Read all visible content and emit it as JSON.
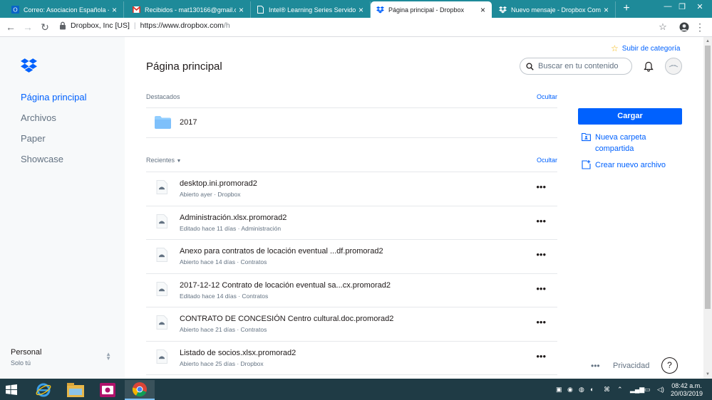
{
  "browser": {
    "tabs": [
      {
        "title": "Correo: Asociacion Española - C",
        "icon": "outlook-icon",
        "active": false
      },
      {
        "title": "Recibidos - mat130166@gmail.co",
        "icon": "gmail-icon",
        "active": false
      },
      {
        "title": "Intel® Learning Series Servidor",
        "icon": "page-icon",
        "active": false
      },
      {
        "title": "Página principal - Dropbox",
        "icon": "dropbox-icon",
        "active": true
      },
      {
        "title": "Nuevo mensaje - Dropbox Com",
        "icon": "dropbox-icon",
        "active": false
      }
    ],
    "site_identity": "Dropbox, Inc [US]",
    "url_host": "https://www.dropbox.com",
    "url_path": "/h",
    "colors": {
      "tabbar": "#1e8a99"
    }
  },
  "sidebar": {
    "items": [
      {
        "label": "Página principal",
        "active": true
      },
      {
        "label": "Archivos",
        "active": false
      },
      {
        "label": "Paper",
        "active": false
      },
      {
        "label": "Showcase",
        "active": false
      }
    ],
    "account": {
      "name": "Personal",
      "subtitle": "Solo tú"
    }
  },
  "header": {
    "title": "Página principal",
    "upgrade_label": "Subir de categoría",
    "search_placeholder": "Buscar en tu contenido"
  },
  "featured": {
    "heading": "Destacados",
    "hide_label": "Ocultar",
    "items": [
      {
        "name": "2017",
        "icon": "folder-icon"
      }
    ]
  },
  "recent": {
    "heading": "Recientes",
    "hide_label": "Ocultar",
    "items": [
      {
        "name": "desktop.ini.promorad2",
        "meta": "Abierto ayer · Dropbox"
      },
      {
        "name": "Administración.xlsx.promorad2",
        "meta": "Editado hace 11 días · Administración"
      },
      {
        "name": "Anexo para contratos de locación eventual ...df.promorad2",
        "meta": "Abierto hace 14 días · Contratos"
      },
      {
        "name": "2017-12-12 Contrato de locación eventual sa...cx.promorad2",
        "meta": "Editado hace 14 días · Contratos"
      },
      {
        "name": "CONTRATO DE CONCESIÓN Centro cultural.doc.promorad2",
        "meta": "Abierto hace 21 días · Contratos"
      },
      {
        "name": "Listado de socios.xlsx.promorad2",
        "meta": "Abierto hace 25 días · Dropbox"
      }
    ],
    "more_label": "•••"
  },
  "actions": {
    "upload_label": "Cargar",
    "new_shared_folder_line1": "Nueva carpeta",
    "new_shared_folder_line2": "compartida",
    "create_file_label": "Crear nuevo archivo"
  },
  "footer": {
    "more_label": "•••",
    "privacy_label": "Privacidad",
    "help_label": "?"
  },
  "taskbar": {
    "time": "08:42 a.m.",
    "date": "20/03/2019",
    "apps": [
      "internet-explorer-icon",
      "file-explorer-icon",
      "media-app-icon",
      "chrome-icon"
    ]
  },
  "colors": {
    "accent": "#0061fe",
    "sidebar_bg": "#f7f9fa",
    "taskbar": "#1f3b45"
  }
}
